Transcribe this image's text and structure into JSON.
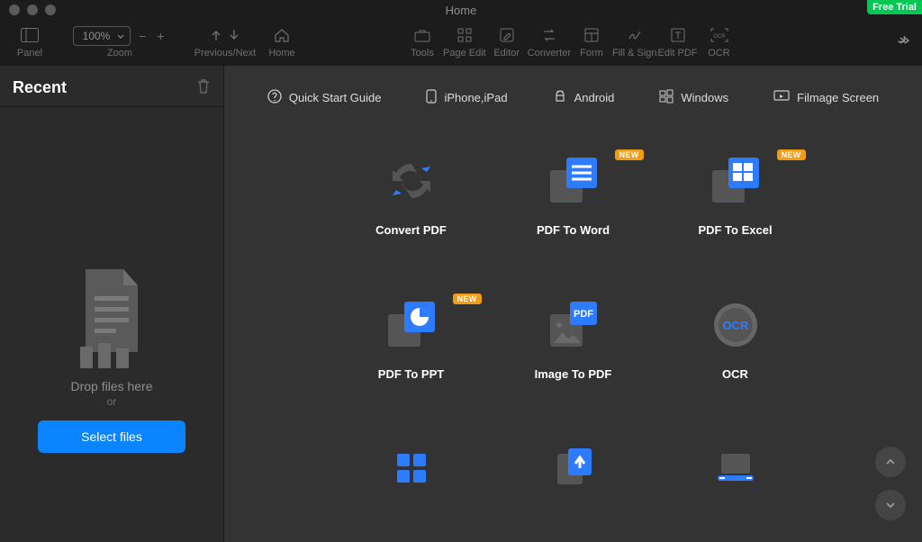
{
  "window": {
    "title": "Home",
    "free_trial": "Free Trial"
  },
  "toolbar": {
    "panel": "Panel",
    "zoom_label": "Zoom",
    "zoom_value": "100%",
    "minus": "−",
    "plus": "+",
    "prevnext": "Previous/Next",
    "home": "Home",
    "tools": "Tools",
    "page_edit": "Page Edit",
    "editor": "Editor",
    "converter": "Converter",
    "form": "Form",
    "fillsign": "Fill & Sign",
    "editpdf": "Edit PDF",
    "ocr": "OCR"
  },
  "sidebar": {
    "title": "Recent",
    "drop_line1": "Drop files here",
    "drop_line2": "or",
    "select_btn": "Select files"
  },
  "links": {
    "quickstart": "Quick Start Guide",
    "iphone": "iPhone,iPad",
    "android": "Android",
    "windows": "Windows",
    "filmage": "Filmage Screen"
  },
  "tiles": {
    "convert_pdf": "Convert PDF",
    "pdf_word": "PDF To Word",
    "pdf_excel": "PDF To Excel",
    "pdf_ppt": "PDF To PPT",
    "image_pdf": "Image To PDF",
    "ocr": "OCR",
    "new_badge": "NEW"
  }
}
